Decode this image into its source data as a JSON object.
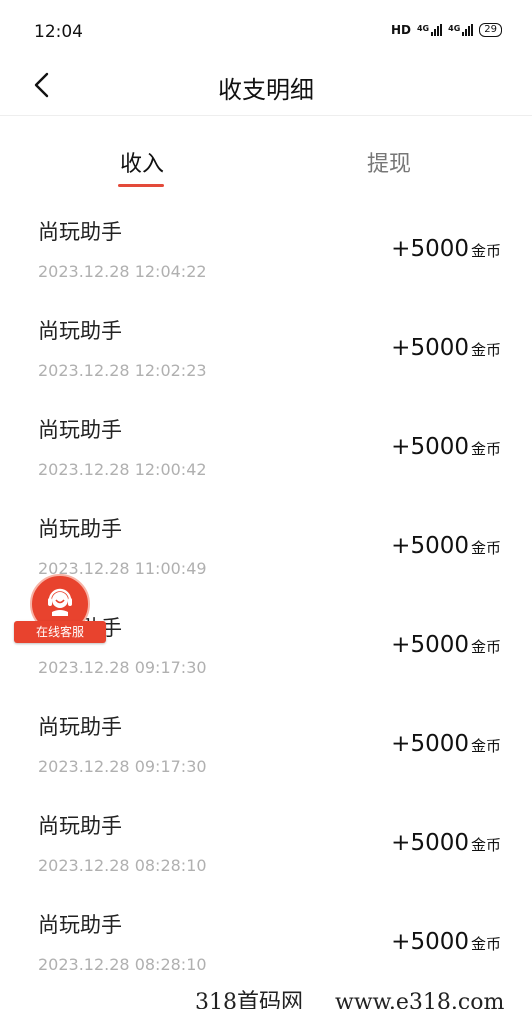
{
  "status_bar": {
    "time": "12:04",
    "hd_label": "HD",
    "net1": "4G",
    "net2": "4G",
    "battery": "29"
  },
  "header": {
    "title": "收支明细",
    "back_icon": "chevron-left-icon"
  },
  "tabs": [
    {
      "label": "收入",
      "active": true
    },
    {
      "label": "提现",
      "active": false
    }
  ],
  "accent_color": "#e34a3a",
  "records": [
    {
      "name": "尚玩助手",
      "time": "2023.12.28 12:04:22",
      "amount": "+5000",
      "unit": "金币"
    },
    {
      "name": "尚玩助手",
      "time": "2023.12.28 12:02:23",
      "amount": "+5000",
      "unit": "金币"
    },
    {
      "name": "尚玩助手",
      "time": "2023.12.28 12:00:42",
      "amount": "+5000",
      "unit": "金币"
    },
    {
      "name": "尚玩助手",
      "time": "2023.12.28 11:00:49",
      "amount": "+5000",
      "unit": "金币"
    },
    {
      "name": "尚玩助手",
      "time": "2023.12.28 09:17:30",
      "amount": "+5000",
      "unit": "金币"
    },
    {
      "name": "尚玩助手",
      "time": "2023.12.28 09:17:30",
      "amount": "+5000",
      "unit": "金币"
    },
    {
      "name": "尚玩助手",
      "time": "2023.12.28 08:28:10",
      "amount": "+5000",
      "unit": "金币"
    },
    {
      "name": "尚玩助手",
      "time": "2023.12.28 08:28:10",
      "amount": "+5000",
      "unit": "金币"
    }
  ],
  "customer_service": {
    "label": "在线客服",
    "icon": "headset-agent-icon"
  },
  "watermark": {
    "site": "318首码网",
    "url": "www.e318.com"
  }
}
